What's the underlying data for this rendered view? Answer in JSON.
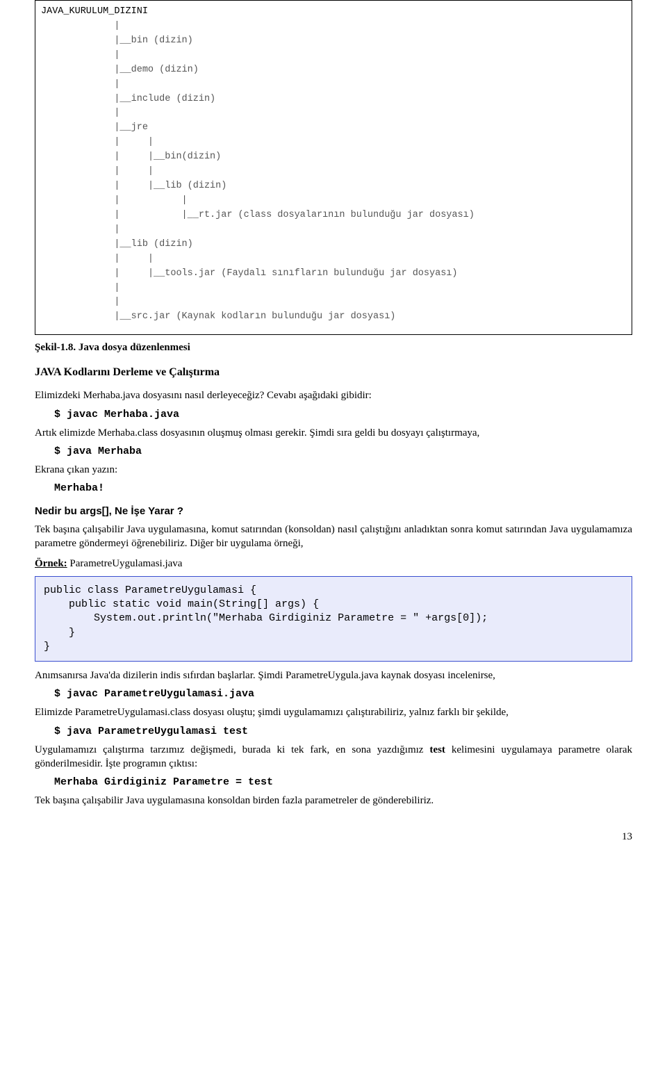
{
  "tree": {
    "root": "JAVA_KURULUM_DIZINI",
    "l1": "|__bin (dizin)",
    "l2": "|__demo (dizin)",
    "l3": "|__include (dizin)",
    "l4": "|__jre",
    "l5": "|__bin(dizin)",
    "l6": "|__lib (dizin)",
    "l7": "|__rt.jar (class dosyalarının bulunduğu jar dosyası)",
    "l8": "|__lib (dizin)",
    "l9": "|__tools.jar (Faydalı sınıfların bulunduğu jar dosyası)",
    "l10": "|__src.jar (Kaynak kodların bulunduğu jar dosyası)"
  },
  "caption": "Şekil-1.8. Java dosya düzenlenmesi",
  "heading1": "JAVA Kodlarını Derleme ve Çalıştırma",
  "p1": "Elimizdeki Merhaba.java dosyasını nasıl derleyeceğiz? Cevabı aşağıdaki gibidir:",
  "cmd1": "$ javac Merhaba.java",
  "p2": "Artık elimizde Merhaba.class dosyasının oluşmuş olması gerekir. Şimdi sıra geldi bu dosyayı çalıştırmaya,",
  "cmd2": "$ java Merhaba",
  "p3": "Ekrana çıkan yazın:",
  "cmd3": "Merhaba!",
  "heading2": "Nedir bu args[], Ne İşe Yarar ?",
  "p4": "Tek başına çalışabilir Java uygulamasına, komut satırından (konsoldan) nasıl çalıştığını anladıktan sonra komut satırından Java uygulamamıza parametre göndermeyi öğrenebiliriz. Diğer bir uygulama örneği,",
  "example_label": "Örnek:",
  "example_file": " ParametreUygulamasi.java",
  "code": "public class ParametreUygulamasi {\n    public static void main(String[] args) {\n        System.out.println(\"Merhaba Girdiginiz Parametre = \" +args[0]);\n    }\n}",
  "p5": "Anımsanırsa Java'da dizilerin indis sıfırdan başlarlar. Şimdi ParametreUygula.java kaynak dosyası incelenirse,",
  "cmd4": "$ javac ParametreUygulamasi.java",
  "p6": "Elimizde ParametreUygulamasi.class dosyası oluştu; şimdi uygulamamızı çalıştırabiliriz, yalnız farklı bir şekilde,",
  "cmd5": "$ java ParametreUygulamasi test",
  "p7a": "Uygulamamızı çalıştırma tarzımız değişmedi, burada ki tek fark, en sona yazdığımız ",
  "p7b": "test",
  "p7c": " kelimesini uygulamaya parametre olarak gönderilmesidir. İşte programın çıktısı:",
  "cmd6": "Merhaba Girdiginiz Parametre = test",
  "p8": "Tek başına çalışabilir Java uygulamasına konsoldan birden fazla parametreler de gönderebiliriz.",
  "pagenum": "13"
}
